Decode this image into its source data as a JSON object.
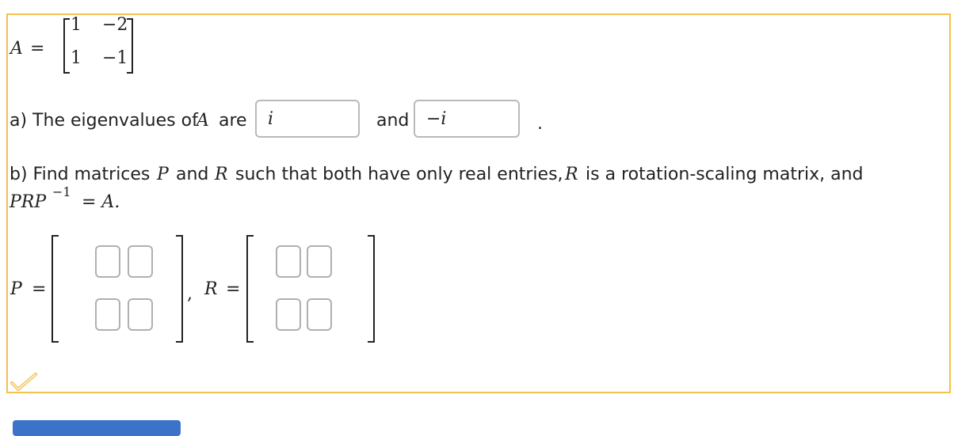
{
  "matrix_A": {
    "name": "A",
    "equals": "=",
    "rows": [
      [
        "1",
        "−2"
      ],
      [
        "1",
        "−1"
      ]
    ]
  },
  "part_a": {
    "prefix": "a) The eigenvalues of",
    "variable": "A",
    "are": "are",
    "and": "and",
    "period": ".",
    "answer1": "i",
    "answer2": "−i"
  },
  "part_b": {
    "line1_prefix": "b) Find matrices",
    "var_P": "P",
    "and1": "and",
    "var_R": "R",
    "line1_mid": "such that both have only real entries,",
    "var_R2": "R",
    "line1_end": "is a rotation-scaling matrix, and",
    "eq_lhs": "PRP",
    "eq_exp": "−1",
    "eq_rhs": "= A."
  },
  "matrix_inputs": {
    "P_label": "P",
    "R_label": "R",
    "equals": "=",
    "comma": ",",
    "P_cells": [
      "",
      "",
      "",
      ""
    ],
    "R_cells": [
      "",
      "",
      "",
      ""
    ]
  },
  "status": {
    "icon": "check-icon",
    "color": "#f2c14e"
  },
  "submit": {
    "color": "#3b73c9"
  }
}
